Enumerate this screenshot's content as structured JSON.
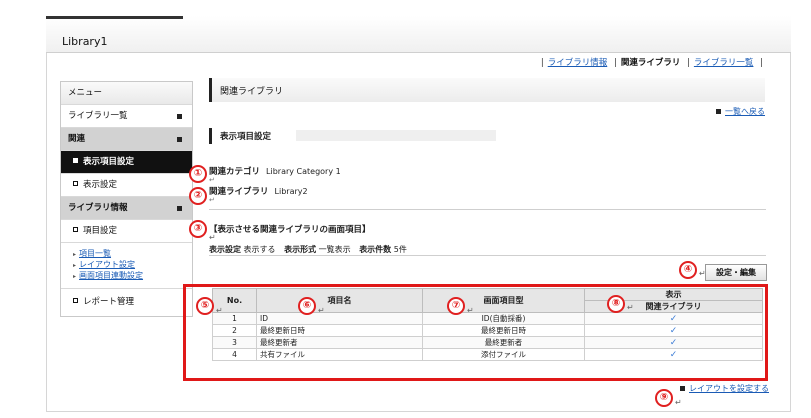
{
  "app": {
    "title": "Library1"
  },
  "topnav": {
    "library_info": "ライブラリ情報",
    "related_library": "関連ライブラリ",
    "library_list": "ライブラリ一覧"
  },
  "menu": {
    "header": "メニュー",
    "library_list": "ライブラリ一覧",
    "related_group": "関連",
    "display_item_settings": "表示項目設定",
    "display_settings": "表示設定",
    "library_info_group": "ライブラリ情報",
    "item_settings": "項目設定",
    "links": [
      "項目一覧",
      "レイアウト設定",
      "画面項目連動設定"
    ],
    "report_management": "レポート管理"
  },
  "main": {
    "page_title": "関連ライブラリ",
    "back_link": "一覧へ戻る",
    "section_title": "表示項目設定",
    "related_category_label": "関連カテゴリ",
    "related_category_value": "Library Category 1",
    "related_library_label": "関連ライブラリ",
    "related_library_value": "Library2",
    "included_items_title": "【表示させる関連ライブラリの画面項目】",
    "display_setting_label": "表示設定",
    "display_setting_value": "表示する",
    "display_format_label": "表示形式",
    "display_format_value": "一覧表示",
    "display_count_label": "表示件数",
    "display_count_value": "5件",
    "edit_button": "設定・編集",
    "layout_link": "レイアウトを設定する",
    "return_mark": "↵"
  },
  "table": {
    "col_no": "No.",
    "col_name": "項目名",
    "col_type": "画面項目型",
    "col_display": "表示",
    "col_display_sub": "関連ライブラリ",
    "rows": [
      {
        "no": "1",
        "name": "ID",
        "type": "ID(自動採番)",
        "check": "✓"
      },
      {
        "no": "2",
        "name": "最終更新日時",
        "type": "最終更新日時",
        "check": "✓"
      },
      {
        "no": "3",
        "name": "最終更新者",
        "type": "最終更新者",
        "check": "✓"
      },
      {
        "no": "4",
        "name": "共有ファイル",
        "type": "添付ファイル",
        "check": "✓"
      }
    ]
  },
  "badges": [
    "①",
    "②",
    "③",
    "④",
    "⑤",
    "⑥",
    "⑦",
    "⑧",
    "⑨"
  ],
  "colors": {
    "annotation": "#e01818",
    "link": "#1a5bb5",
    "check": "#3a7bd5"
  }
}
